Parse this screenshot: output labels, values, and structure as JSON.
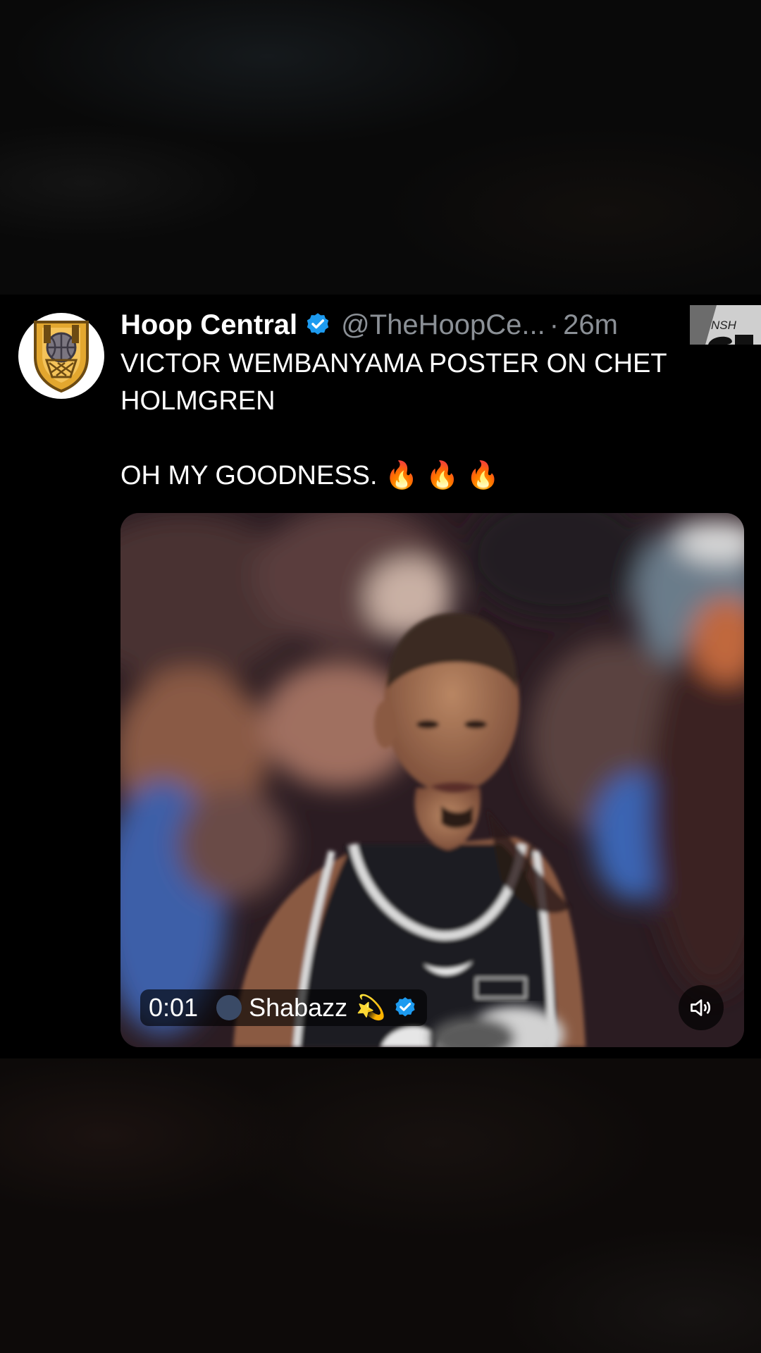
{
  "tweet": {
    "display_name": "Hoop Central",
    "handle": "@TheHoopCe...",
    "separator": "·",
    "time": "26m",
    "text_lines": [
      "VICTOR WEMBANYAMA POSTER ON CHET",
      "HOLMGREN",
      "OH MY GOODNESS."
    ],
    "emoji": "🔥 🔥 🔥",
    "avatar_icon": "hoop-central-shield-logo",
    "verified_icon": "verified-badge-icon",
    "verified_color": "#1d9bf0"
  },
  "video": {
    "timestamp": "0:01",
    "user": "Shabazz",
    "user_emoji": "💫",
    "mute_icon": "speaker-muted-icon"
  },
  "thumbnail": {
    "text": "NSH"
  },
  "colors": {
    "background": "#000000",
    "text": "#ffffff",
    "muted_text": "#8b9096",
    "accent": "#1d9bf0"
  }
}
